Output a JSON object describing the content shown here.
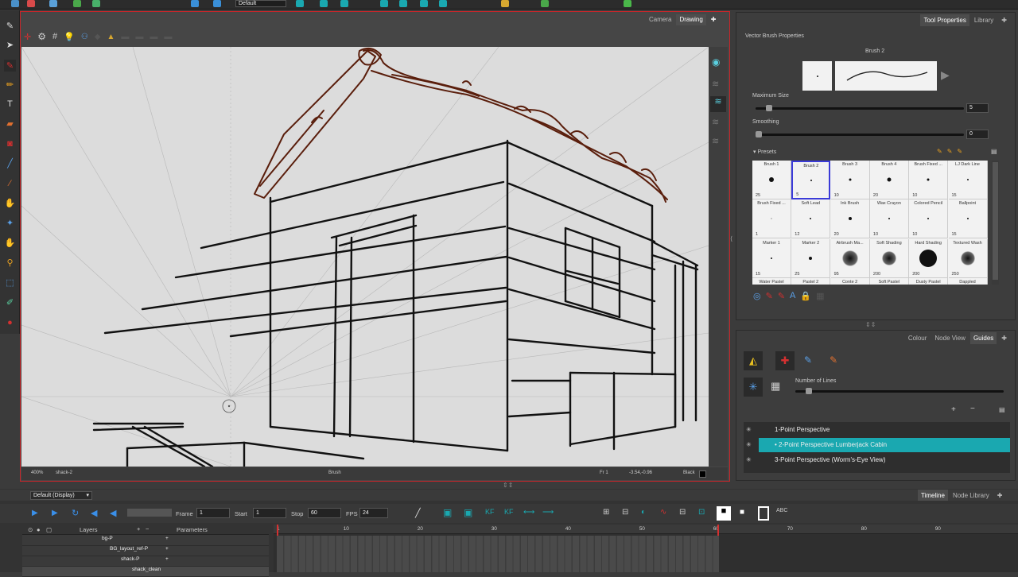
{
  "toolbar": {
    "workspace": "Default"
  },
  "view": {
    "tabs": [
      "Camera",
      "Drawing"
    ],
    "active_tab": "Drawing"
  },
  "status": {
    "zoom": "400%",
    "drawing": "shack-2",
    "tool": "Brush",
    "frame": "Fr 1",
    "coords": "-3.54,-0.96",
    "color": "Black"
  },
  "tool_properties": {
    "tabs": [
      "Tool Properties",
      "Library"
    ],
    "active_tab": "Tool Properties",
    "title": "Vector Brush Properties",
    "brush_name": "Brush 2",
    "max_size_label": "Maximum Size",
    "max_size_value": "5",
    "max_size_level": 0.05,
    "smoothing_label": "Smoothing",
    "smoothing_value": "0",
    "smoothing_level": 0.0,
    "presets_label": "Presets",
    "presets": [
      {
        "name": "Brush 1",
        "size": "25",
        "dot": 6
      },
      {
        "name": "Brush 2",
        "size": "5",
        "dot": 2,
        "selected": true
      },
      {
        "name": "Brush 3",
        "size": "10",
        "dot": 3
      },
      {
        "name": "Brush 4",
        "size": "20",
        "dot": 5
      },
      {
        "name": "Brush Fixed ...",
        "size": "10",
        "dot": 3
      },
      {
        "name": "LJ Dark Line",
        "size": "15",
        "dot": 2
      },
      {
        "name": "Brush Fixed ...",
        "size": "1",
        "dot": 1
      },
      {
        "name": "Soft Lead",
        "size": "12",
        "dot": 2
      },
      {
        "name": "Ink Brush",
        "size": "20",
        "dot": 4
      },
      {
        "name": "Wax Crayon",
        "size": "10",
        "dot": 2
      },
      {
        "name": "Colored Pencil",
        "size": "10",
        "dot": 2
      },
      {
        "name": "Ballpoint",
        "size": "15",
        "dot": 2
      },
      {
        "name": "Marker 1",
        "size": "15",
        "dot": 2
      },
      {
        "name": "Marker 2",
        "size": "25",
        "dot": 4
      },
      {
        "name": "Airbrush Ma...",
        "size": "95",
        "dot": 20
      },
      {
        "name": "Soft Shading",
        "size": "200",
        "dot": 18
      },
      {
        "name": "Hard Shading",
        "size": "200",
        "dot": 22
      },
      {
        "name": "Textured Wash",
        "size": "250",
        "dot": 18
      },
      {
        "name": "Water Pastel",
        "size": "",
        "dot": 0
      },
      {
        "name": "Pastel 2",
        "size": "",
        "dot": 0
      },
      {
        "name": "Conte 2",
        "size": "",
        "dot": 0
      },
      {
        "name": "Soft Pastel",
        "size": "",
        "dot": 0
      },
      {
        "name": "Dusty Pastel",
        "size": "",
        "dot": 0
      },
      {
        "name": "Dappled",
        "size": "",
        "dot": 0
      }
    ]
  },
  "guides_panel": {
    "tabs": [
      "Colour",
      "Node View",
      "Guides"
    ],
    "active_tab": "Guides",
    "lines_label": "Number of Lines",
    "lines_level": 0.05,
    "items": [
      "1-Point Perspective",
      "2-Point Perspective Lumberjack Cabin",
      "3-Point Perspective (Worm's-Eye View)"
    ],
    "selected_index": 1
  },
  "timeline": {
    "tabs": [
      "Timeline",
      "Node Library"
    ],
    "active_tab": "Timeline",
    "display": "Default (Display)",
    "frame_label": "Frame",
    "frame": "1",
    "start_label": "Start",
    "start": "1",
    "stop_label": "Stop",
    "stop": "60",
    "fps_label": "FPS",
    "fps": "24",
    "layers_label": "Layers",
    "params_label": "Parameters",
    "layers": [
      "bg-P",
      "BG_layout_ref-P",
      "shack-P",
      "shack_clean"
    ],
    "ruler": [
      "1",
      "10",
      "20",
      "30",
      "40",
      "50",
      "60",
      "70",
      "80",
      "90"
    ],
    "playhead": "1",
    "end_marker": "60"
  },
  "colors": {
    "accent": "#1aa8b0",
    "red_border": "#c8262a",
    "brown": "#5a1e0c"
  }
}
